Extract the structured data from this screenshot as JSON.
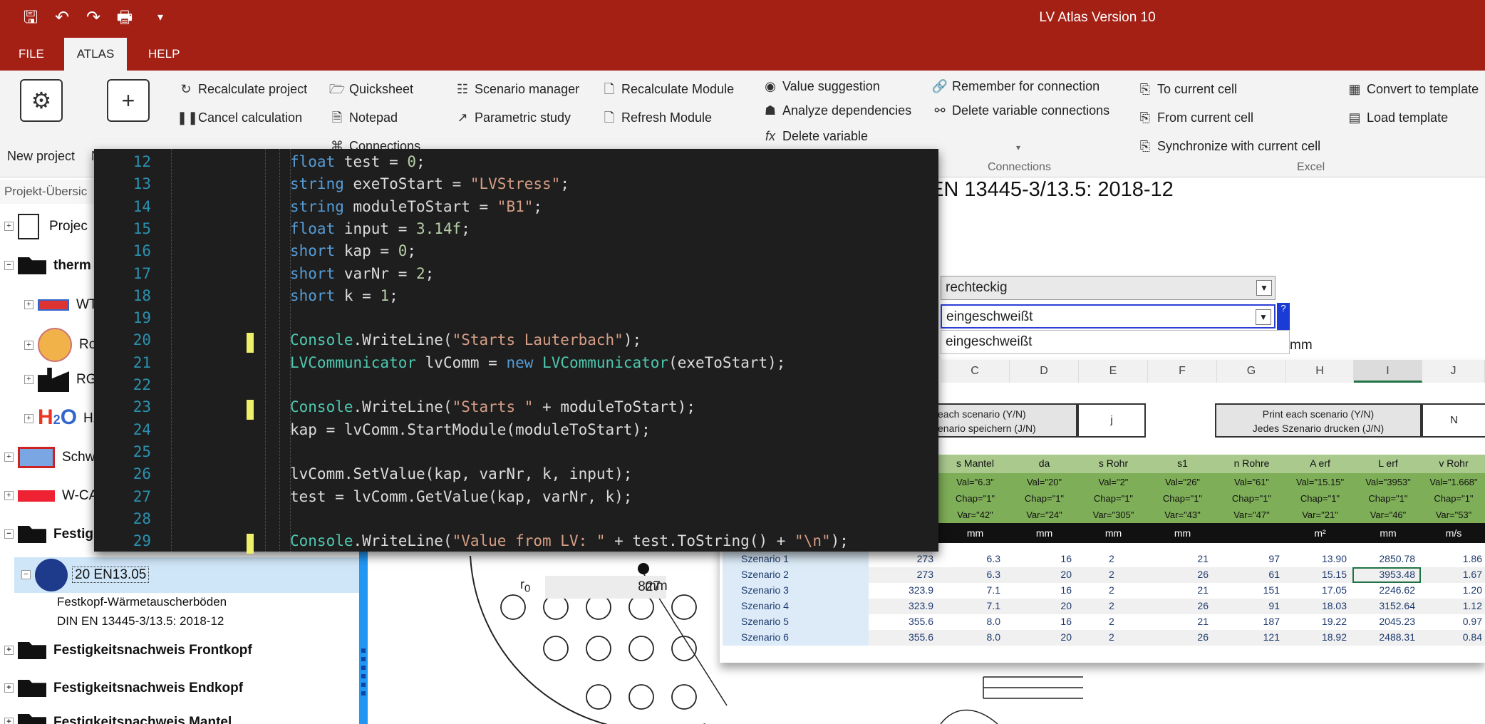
{
  "app": {
    "title": "LV Atlas Version 10"
  },
  "quick_access": [
    "save-icon",
    "undo-icon",
    "redo-icon",
    "print-icon",
    "customize-icon"
  ],
  "menu": {
    "file": "FILE",
    "atlas": "ATLAS",
    "help": "HELP"
  },
  "ribbon": {
    "new_project": "New project",
    "recalculate_project": "Recalculate project",
    "cancel_calculation": "Cancel calculation",
    "quicksheet": "Quicksheet",
    "notepad": "Notepad",
    "connections_btn": "Connections",
    "scenario_manager": "Scenario manager",
    "parametric_study": "Parametric study",
    "recalculate_module": "Recalculate Module",
    "refresh_module": "Refresh Module",
    "value_suggestion": "Value suggestion",
    "analyze_dependencies": "Analyze dependencies",
    "delete_variable": "Delete variable",
    "remember_connection": "Remember for connection",
    "delete_variable_connections": "Delete variable connections",
    "connections_group": "Connections",
    "to_current_cell": "To current cell",
    "from_current_cell": "From current cell",
    "synchronize": "Synchronize with current cell",
    "excel_group": "Excel",
    "convert_to_template": "Convert to template",
    "load_template": "Load template"
  },
  "project_tree": {
    "header": "Projekt-Übersic",
    "items": [
      {
        "label": "Projec"
      },
      {
        "label": "therm"
      },
      {
        "label": "WT"
      },
      {
        "label": "Ro"
      },
      {
        "label": "RG"
      },
      {
        "label": "H2"
      },
      {
        "label": "Schwi"
      },
      {
        "label": "W-CA"
      },
      {
        "label": "Festig"
      },
      {
        "label": "20 EN13.05"
      },
      {
        "label": "Festkopf-Wärmetauscherböden"
      },
      {
        "label": "DIN EN 13445-3/13.5: 2018-12"
      },
      {
        "label": "Festigkeitsnachweis Frontkopf"
      },
      {
        "label": "Festigkeitsnachweis Endkopf"
      },
      {
        "label": "Festigkeitsnachweis Mantel"
      }
    ]
  },
  "document": {
    "title": "EN 13445-3/13.5: 2018-12",
    "combo1": "rechteckig",
    "combo2": "eingeschweißt",
    "dropdown_option": "eingeschweißt",
    "unit_mm": "mm",
    "r0_label": "r",
    "r0_sub": "0",
    "r0_value": "827",
    "r0_unit": "mm"
  },
  "sheet": {
    "columns": [
      "C",
      "D",
      "E",
      "F",
      "G",
      "H",
      "I",
      "J"
    ],
    "left_box": {
      "line1": "each scenario (Y/N)",
      "line2": "enario speichern (J/N)",
      "value": "j"
    },
    "right_box": {
      "line1": "Print each scenario (Y/N)",
      "line2": "Jedes Szenario drucken (J/N)",
      "value": "N"
    },
    "green_headers": [
      "s Mantel",
      "da",
      "s Rohr",
      "s1",
      "n Rohre",
      "A erf",
      "L erf",
      "v Rohr"
    ],
    "green_val": [
      "Val=\"6.3\"",
      "Val=\"20\"",
      "Val=\"2\"",
      "Val=\"26\"",
      "Val=\"61\"",
      "Val=\"15.15\"",
      "Val=\"3953\"",
      "Val=\"1.668\""
    ],
    "green_chap": [
      "Chap=\"1\"",
      "Chap=\"1\"",
      "Chap=\"1\"",
      "Chap=\"1\"",
      "Chap=\"1\"",
      "Chap=\"1\"",
      "Chap=\"1\"",
      "Chap=\"1\""
    ],
    "green_var": [
      "Var=\"42\"",
      "Var=\"24\"",
      "Var=\"305\"",
      "Var=\"43\"",
      "Var=\"47\"",
      "Var=\"21\"",
      "Var=\"46\"",
      "Var=\"53\""
    ],
    "units": [
      "mm",
      "mm",
      "mm",
      "mm",
      "",
      "m²",
      "mm",
      "m/s"
    ],
    "rows": [
      [
        "Szenario 1",
        "273",
        "6.3",
        "16",
        "2",
        "21",
        "97",
        "13.90",
        "2850.78",
        "1.86"
      ],
      [
        "Szenario 2",
        "273",
        "6.3",
        "20",
        "2",
        "26",
        "61",
        "15.15",
        "3953.48",
        "1.67"
      ],
      [
        "Szenario 3",
        "323.9",
        "7.1",
        "16",
        "2",
        "21",
        "151",
        "17.05",
        "2246.62",
        "1.20"
      ],
      [
        "Szenario 4",
        "323.9",
        "7.1",
        "20",
        "2",
        "26",
        "91",
        "18.03",
        "3152.64",
        "1.12"
      ],
      [
        "Szenario 5",
        "355.6",
        "8.0",
        "16",
        "2",
        "21",
        "187",
        "19.22",
        "2045.23",
        "0.97"
      ],
      [
        "Szenario 6",
        "355.6",
        "8.0",
        "20",
        "2",
        "26",
        "121",
        "18.92",
        "2488.31",
        "0.84"
      ]
    ]
  },
  "code": {
    "lines": [
      {
        "n": "12",
        "t": "float test = 0;"
      },
      {
        "n": "13",
        "t": "string exeToStart = \"LVStress\";"
      },
      {
        "n": "14",
        "t": "string moduleToStart = \"B1\";"
      },
      {
        "n": "15",
        "t": "float input = 3.14f;"
      },
      {
        "n": "16",
        "t": "short kap = 0;"
      },
      {
        "n": "17",
        "t": "short varNr = 2;"
      },
      {
        "n": "18",
        "t": "short k = 1;"
      },
      {
        "n": "19",
        "t": ""
      },
      {
        "n": "20",
        "t": "Console.WriteLine(\"Starts Lauterbach\");"
      },
      {
        "n": "21",
        "t": "LVCommunicator lvComm = new LVCommunicator(exeToStart);"
      },
      {
        "n": "22",
        "t": ""
      },
      {
        "n": "23",
        "t": "Console.WriteLine(\"Starts \" + moduleToStart);"
      },
      {
        "n": "24",
        "t": "kap = lvComm.StartModule(moduleToStart);"
      },
      {
        "n": "25",
        "t": ""
      },
      {
        "n": "26",
        "t": "lvComm.SetValue(kap, varNr, k, input);"
      },
      {
        "n": "27",
        "t": "test = lvComm.GetValue(kap, varNr, k);"
      },
      {
        "n": "28",
        "t": ""
      },
      {
        "n": "29",
        "t": "Console.WriteLine(\"Value from LV: \" + test.ToString() + \"\\n\");"
      }
    ]
  },
  "colors": {
    "titlebar": "#a41f14",
    "ribbon": "#f3f3f3",
    "code_bg": "#1e1e1e",
    "header_green": "#a9c98d",
    "accent_blue": "#2196f3"
  }
}
